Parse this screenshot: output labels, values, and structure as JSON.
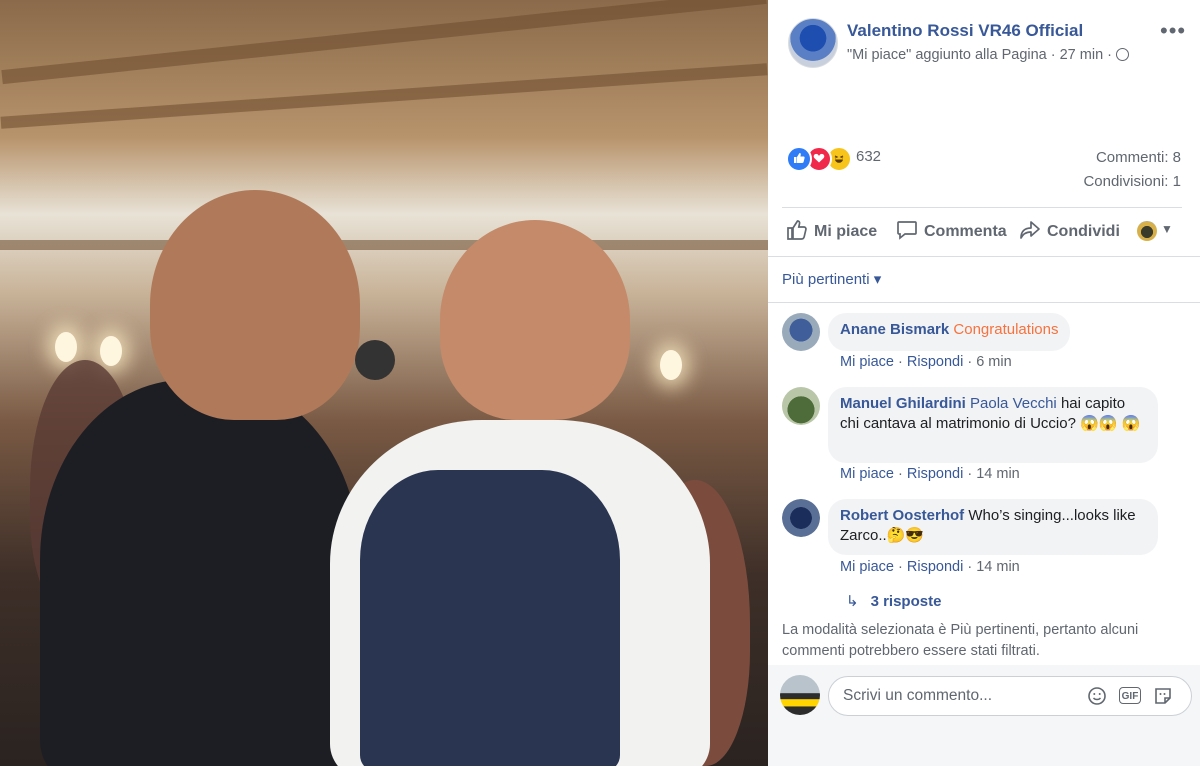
{
  "post": {
    "page_name": "Valentino Rossi VR46 Official",
    "subtitle": "\"Mi piace\" aggiunto alla Pagina · 27 min ·",
    "more_label": "•••",
    "reaction_count": "632",
    "comments_count": "Commenti: 8",
    "shares_count": "Condivisioni: 1",
    "reactions": [
      "like-icon",
      "love-icon",
      "haha-icon"
    ]
  },
  "actions": {
    "like": "Mi piace",
    "comment": "Commenta",
    "share": "Condividi"
  },
  "filter": {
    "label": "Più pertinenti ▾"
  },
  "comments": [
    {
      "author": "Anane Bismark",
      "text": "Congratulations",
      "like": "Mi piace",
      "reply": "Rispondi",
      "time": "6 min"
    },
    {
      "author": "Manuel Ghilardini",
      "mention": "Paola Vecchi",
      "text": "hai capito chi cantava al matrimonio di Uccio? 😱😱 😱",
      "like": "Mi piace",
      "reply": "Rispondi",
      "time": "14 min"
    },
    {
      "author": "Robert Oosterhof",
      "text": "Who’s singing...looks like Zarco..🤔😎",
      "like": "Mi piace",
      "reply": "Rispondi",
      "time": "14 min"
    }
  ],
  "replies": {
    "label": "3 risposte"
  },
  "note": "La modalità selezionata è Più pertinenti, pertanto alcuni commenti potrebbero essere stati filtrati.",
  "composer": {
    "placeholder": "Scrivi un commento...",
    "gif": "GIF"
  },
  "colors": {
    "link": "#385898",
    "meta": "#606770",
    "bubble": "#f2f3f5",
    "like_blue": "#2f7cf6",
    "love_red": "#f0284a",
    "haha_yellow": "#f7c41c",
    "congrats_orange": "#f7723e"
  }
}
